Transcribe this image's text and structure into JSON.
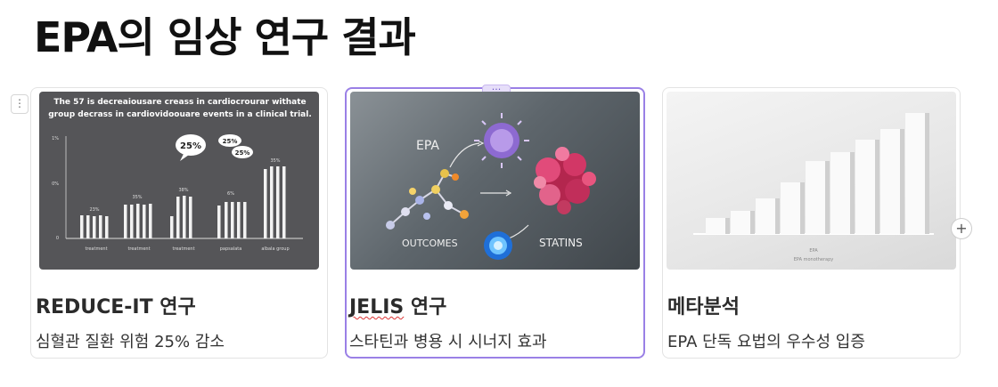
{
  "page": {
    "title": "EPA의 임상 연구 결과"
  },
  "cards": [
    {
      "title": "REDUCE-IT 연구",
      "description": "심혈관 질환 위험 25% 감소",
      "image": {
        "heading_line1": "The 57 is decreaiousare creass in cardiocrourar withate",
        "heading_line2": "group decrass in cardiovidoouare events in a clinical trial.",
        "y_ticks": [
          "1%",
          "0%",
          "0"
        ],
        "bubbles": [
          "25%",
          "25%",
          "25%"
        ],
        "group_labels": [
          "treatment",
          "treatment",
          "treatment",
          "papsalata",
          "albala group"
        ],
        "value_labels": [
          "23%",
          "35%",
          "38%",
          "6%",
          "35%"
        ]
      }
    },
    {
      "title_word": "JELIS",
      "title_rest": " 연구",
      "description": "스타틴과 병용 시 시너지 효과",
      "image": {
        "label_epa": "EPA",
        "label_outcomes": "OUTCOMES",
        "label_statins": "STATINS"
      }
    },
    {
      "title": "메타분석",
      "description": "EPA 단독 요법의 우수성 입증",
      "image": {
        "x_label_line1": "EPA",
        "x_label_line2": "EPA monotherapy"
      }
    }
  ],
  "controls": {
    "more_label": "···",
    "add_label": "+",
    "drag_label": "⋮"
  }
}
